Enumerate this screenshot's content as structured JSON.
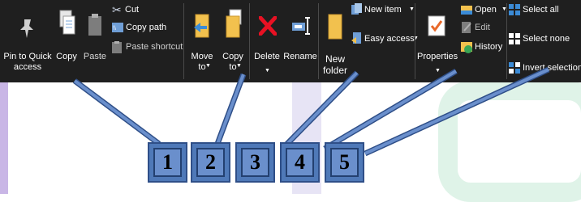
{
  "ribbon": {
    "clipboard": {
      "pin_label": "Pin to Quick access",
      "copy_label": "Copy",
      "paste_label": "Paste",
      "cut_label": "Cut",
      "copy_path_label": "Copy path",
      "paste_shortcut_label": "Paste shortcut"
    },
    "organize": {
      "move_to_label": "Move to",
      "copy_to_label": "Copy to",
      "delete_label": "Delete",
      "rename_label": "Rename"
    },
    "new": {
      "new_folder_label": "New folder",
      "new_item_label": "New item",
      "easy_access_label": "Easy access"
    },
    "open": {
      "properties_label": "Properties",
      "open_label": "Open",
      "edit_label": "Edit",
      "history_label": "History"
    },
    "select": {
      "select_all_label": "Select all",
      "select_none_label": "Select none",
      "invert_selection_label": "Invert selection"
    }
  },
  "callouts": [
    "1",
    "2",
    "3",
    "4",
    "5"
  ],
  "colors": {
    "ribbon_bg": "#1f1f1f",
    "callout_fill": "#4f79b8",
    "callout_border": "#2f4f88",
    "leader_line": "#4f79b8",
    "delete_red": "#e81123",
    "folder_yellow": "#f2c14e"
  }
}
